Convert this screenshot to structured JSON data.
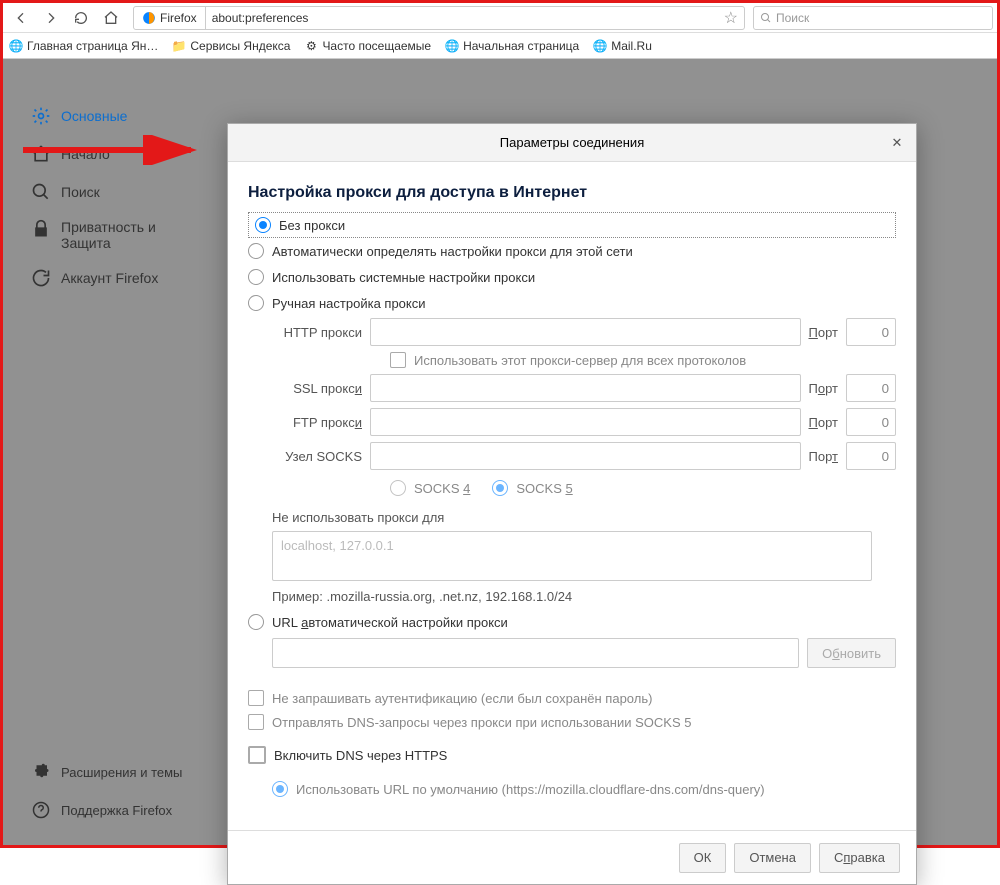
{
  "toolbar": {
    "identity": "Firefox",
    "url": "about:preferences",
    "search_placeholder": "Поиск"
  },
  "bookmarks": {
    "items": [
      "Главная страница Ян…",
      "Сервисы Яндекса",
      "Часто посещаемые",
      "Начальная страница",
      "Mail.Ru"
    ]
  },
  "sidebar": {
    "items": [
      "Основные",
      "Начало",
      "Поиск",
      "Приватность и Защита",
      "Аккаунт Firefox"
    ],
    "bottom": {
      "addons": "Расширения и темы",
      "support": "Поддержка Firefox"
    }
  },
  "dialog": {
    "title": "Параметры соединения",
    "section_title": "Настройка прокси для доступа в Интернет",
    "radios": {
      "no_proxy": "Без прокси",
      "auto_detect": "Автоматически определять настройки прокси для этой сети",
      "system": "Использовать системные настройки прокси",
      "manual": "Ручная настройка прокси"
    },
    "proxy": {
      "http_label": "HTTP прокси",
      "use_all": "Использовать этот прокси-сервер для всех протоколов",
      "ssl_label": "SSL прокси",
      "ftp_label": "FTP прокси",
      "socks_label": "Узел SOCKS",
      "port_label": "Порт",
      "port_value": "0",
      "socks4": "SOCKS 4",
      "socks5": "SOCKS 5"
    },
    "no_proxy_for": {
      "label": "Не использовать прокси для",
      "placeholder": "localhost, 127.0.0.1",
      "example": "Пример: .mozilla-russia.org, .net.nz, 192.168.1.0/24"
    },
    "url_auto": {
      "label": "URL автоматической настройки прокси",
      "reload": "Обновить"
    },
    "checks": {
      "no_auth": "Не запрашивать аутентификацию (если был сохранён пароль)",
      "dns_socks5": "Отправлять DNS-запросы через прокси при использовании SOCKS 5",
      "dns_https": "Включить DNS через HTTPS",
      "dns_default": "Использовать URL по умолчанию (https://mozilla.cloudflare-dns.com/dns-query)"
    },
    "buttons": {
      "ok": "ОК",
      "cancel": "Отмена",
      "help": "Справка"
    }
  }
}
